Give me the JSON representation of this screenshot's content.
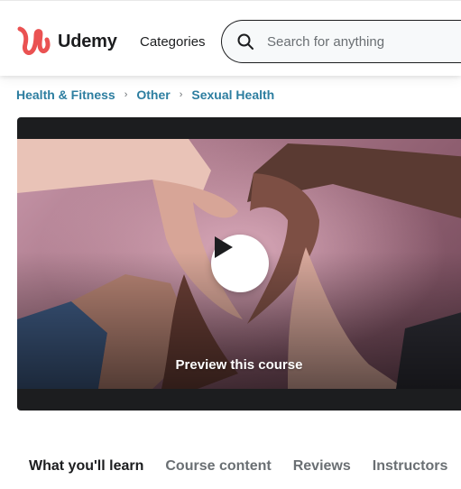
{
  "header": {
    "logo_text": "Udemy",
    "categories_label": "Categories",
    "search_placeholder": "Search for anything",
    "brand_color": "#a435f0",
    "logo_mark_color": "#ea5252"
  },
  "breadcrumb": {
    "items": [
      "Health & Fitness",
      "Other",
      "Sexual Health"
    ],
    "color": "#2d7ea0"
  },
  "preview": {
    "label": "Preview this course",
    "icon": "play-icon"
  },
  "tabs": [
    {
      "label": "What you'll learn",
      "active": true
    },
    {
      "label": "Course content",
      "active": false
    },
    {
      "label": "Reviews",
      "active": false
    },
    {
      "label": "Instructors",
      "active": false
    }
  ]
}
